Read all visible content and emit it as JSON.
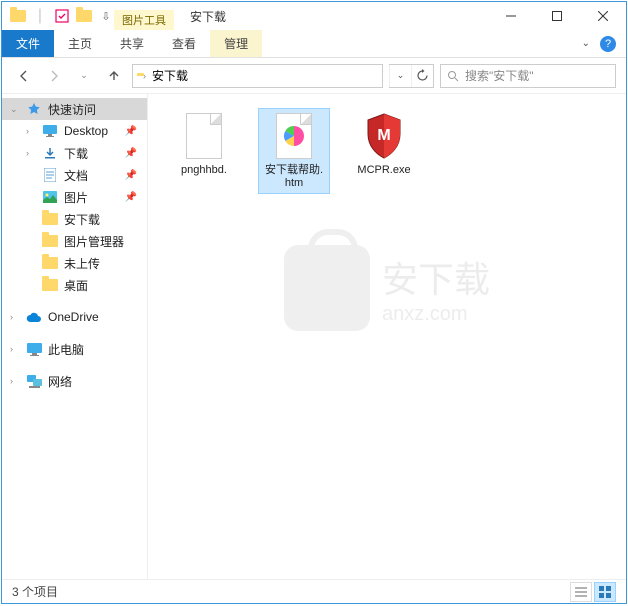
{
  "contextual_tab": "图片工具",
  "window_title": "安下载",
  "ribbon": {
    "file": "文件",
    "tabs": [
      "主页",
      "共享",
      "查看"
    ],
    "context_tab": "管理"
  },
  "breadcrumb": {
    "root_icon": "folder",
    "current": "安下载"
  },
  "search": {
    "placeholder": "搜索\"安下载\""
  },
  "nav": {
    "quick_access": "快速访问",
    "items": [
      {
        "label": "Desktop",
        "icon": "desktop",
        "pinned": true
      },
      {
        "label": "下载",
        "icon": "downloads",
        "pinned": true
      },
      {
        "label": "文档",
        "icon": "documents",
        "pinned": true
      },
      {
        "label": "图片",
        "icon": "pictures",
        "pinned": true
      },
      {
        "label": "安下载",
        "icon": "folder",
        "pinned": false
      },
      {
        "label": "图片管理器",
        "icon": "folder",
        "pinned": false
      },
      {
        "label": "未上传",
        "icon": "folder",
        "pinned": false
      },
      {
        "label": "桌面",
        "icon": "folder",
        "pinned": false
      }
    ],
    "onedrive": "OneDrive",
    "this_pc": "此电脑",
    "network": "网络"
  },
  "files": [
    {
      "name": "pnghhbd.",
      "type": "blank"
    },
    {
      "name": "安下载帮助.htm",
      "type": "htm",
      "selected": true
    },
    {
      "name": "MCPR.exe",
      "type": "exe"
    }
  ],
  "status": {
    "count": "3 个项目"
  },
  "watermark": {
    "text": "安下载",
    "sub": "anxz.com"
  }
}
